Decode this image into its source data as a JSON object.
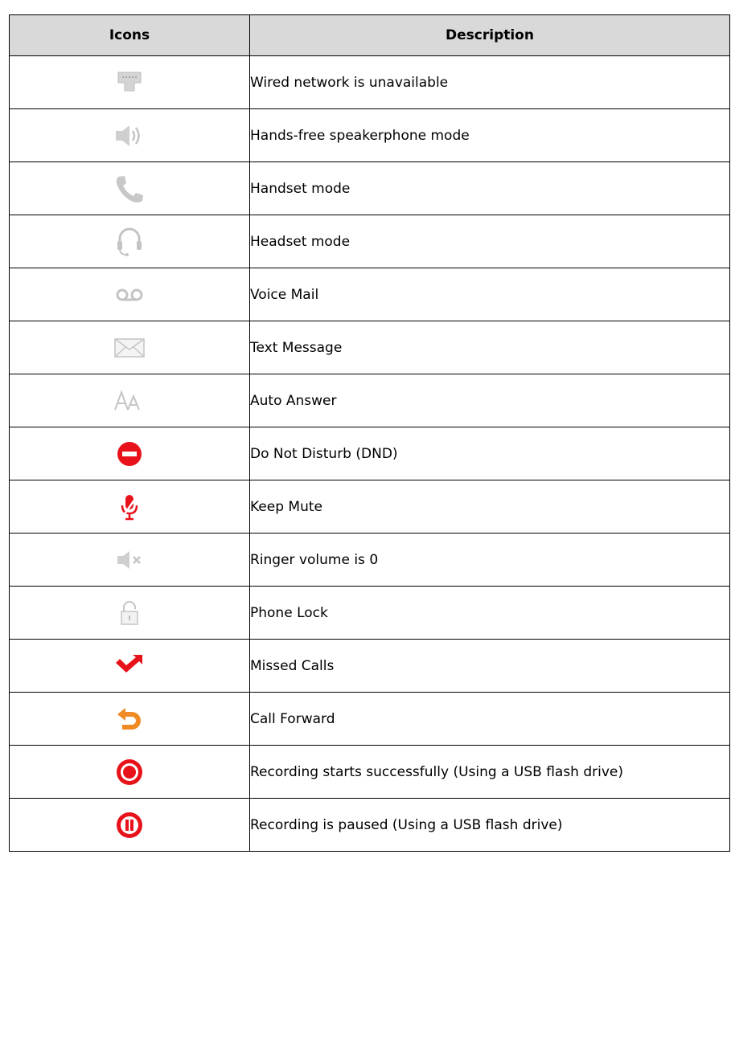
{
  "table": {
    "headers": {
      "icons": "Icons",
      "description": "Description"
    },
    "rows": [
      {
        "icon": "wired-network-unavailable-icon",
        "description": "Wired network is unavailable"
      },
      {
        "icon": "speakerphone-icon",
        "description": "Hands-free speakerphone mode"
      },
      {
        "icon": "handset-icon",
        "description": "Handset mode"
      },
      {
        "icon": "headset-icon",
        "description": "Headset mode"
      },
      {
        "icon": "voicemail-icon",
        "description": "Voice Mail"
      },
      {
        "icon": "envelope-icon",
        "description": "Text Message"
      },
      {
        "icon": "auto-answer-icon",
        "description": "Auto Answer"
      },
      {
        "icon": "do-not-disturb-icon",
        "description": "Do Not Disturb (DND)"
      },
      {
        "icon": "mute-microphone-icon",
        "description": "Keep Mute"
      },
      {
        "icon": "ringer-muted-icon",
        "description": "Ringer volume is 0"
      },
      {
        "icon": "phone-lock-icon",
        "description": "Phone Lock"
      },
      {
        "icon": "missed-call-icon",
        "description": "Missed Calls"
      },
      {
        "icon": "call-forward-icon",
        "description": "Call Forward"
      },
      {
        "icon": "recording-icon",
        "description": "Recording starts successfully (Using a USB flash drive)"
      },
      {
        "icon": "recording-paused-icon",
        "description": "Recording is paused (Using a USB flash drive)"
      }
    ]
  },
  "colors": {
    "header_bg": "#d9d9d9",
    "border": "#000000",
    "icon_gray": "#c4c4c4",
    "icon_red": "#e8131a",
    "icon_orange": "#f08a24"
  }
}
